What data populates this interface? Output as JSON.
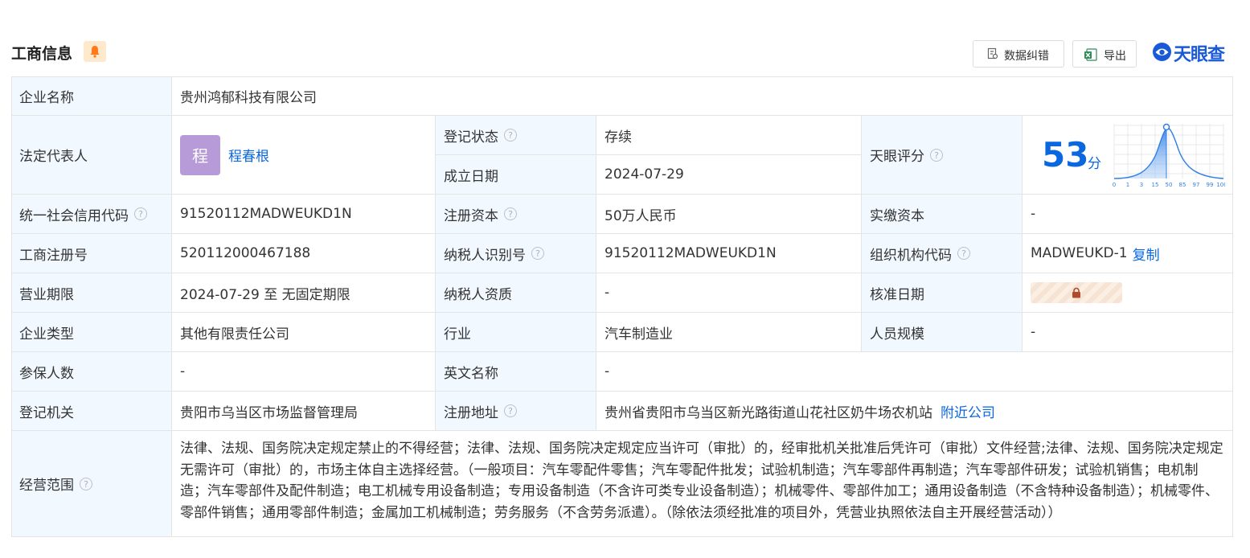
{
  "header": {
    "title": "工商信息",
    "bell_icon": "bell-icon",
    "correction_button": "数据纠错",
    "export_button": "导出",
    "brand_name": "天眼查"
  },
  "colors": {
    "label_bg": "#f2f8ff",
    "link": "#0a67e0",
    "status": "#17a34a",
    "avatar": "#b79bd8",
    "brand": "#1a5ad7"
  },
  "fields": {
    "company_name": {
      "label": "企业名称",
      "value": "贵州鸿郁科技有限公司"
    },
    "legal_rep": {
      "label": "法定代表人",
      "avatar_char": "程",
      "name": "程春根"
    },
    "reg_status": {
      "label": "登记状态",
      "value": "存续"
    },
    "established": {
      "label": "成立日期",
      "value": "2024-07-29"
    },
    "tianyan_score": {
      "label": "天眼评分",
      "value": "53",
      "unit": "分",
      "chart_ticks": [
        "0",
        "1",
        "3",
        "15",
        "50",
        "85",
        "97",
        "99",
        "100"
      ]
    },
    "credit_code": {
      "label": "统一社会信用代码",
      "value": "91520112MADWEUKD1N"
    },
    "reg_capital": {
      "label": "注册资本",
      "value": "50万人民币"
    },
    "paid_capital": {
      "label": "实缴资本",
      "value": "-"
    },
    "biz_reg_no": {
      "label": "工商注册号",
      "value": "520112000467188"
    },
    "taxpayer_id": {
      "label": "纳税人识别号",
      "value": "91520112MADWEUKD1N"
    },
    "org_code": {
      "label": "组织机构代码",
      "value": "MADWEUKD-1",
      "copy": "复制"
    },
    "biz_term": {
      "label": "营业期限",
      "value": "2024-07-29 至 无固定期限"
    },
    "taxpayer_qual": {
      "label": "纳税人资质",
      "value": "-"
    },
    "approval_date": {
      "label": "核准日期",
      "lock_icon": "lock-icon"
    },
    "company_type": {
      "label": "企业类型",
      "value": "其他有限责任公司"
    },
    "industry": {
      "label": "行业",
      "value": "汽车制造业"
    },
    "staff_size": {
      "label": "人员规模",
      "value": "-"
    },
    "insured": {
      "label": "参保人数",
      "value": "-"
    },
    "english_name": {
      "label": "英文名称",
      "value": "-"
    },
    "reg_authority": {
      "label": "登记机关",
      "value": "贵阳市乌当区市场监督管理局"
    },
    "reg_address": {
      "label": "注册地址",
      "value": "贵州省贵阳市乌当区新光路街道山花社区奶牛场农机站",
      "nearby": "附近公司"
    },
    "business_scope": {
      "label": "经营范围",
      "value": "法律、法规、国务院决定规定禁止的不得经营；法律、法规、国务院决定规定应当许可（审批）的，经审批机关批准后凭许可（审批）文件经营;法律、法规、国务院决定规定无需许可（审批）的，市场主体自主选择经营。（一般项目：汽车零配件零售；汽车零配件批发；试验机制造；汽车零部件再制造；汽车零部件研发；试验机销售；电机制造；汽车零部件及配件制造；电工机械专用设备制造；专用设备制造（不含许可类专业设备制造）；机械零件、零部件加工；通用设备制造（不含特种设备制造）；机械零件、零部件销售；通用零部件制造；金属加工机械制造；劳务服务（不含劳务派遣）。（除依法须经批准的项目外，凭营业执照依法自主开展经营活动））"
    }
  }
}
